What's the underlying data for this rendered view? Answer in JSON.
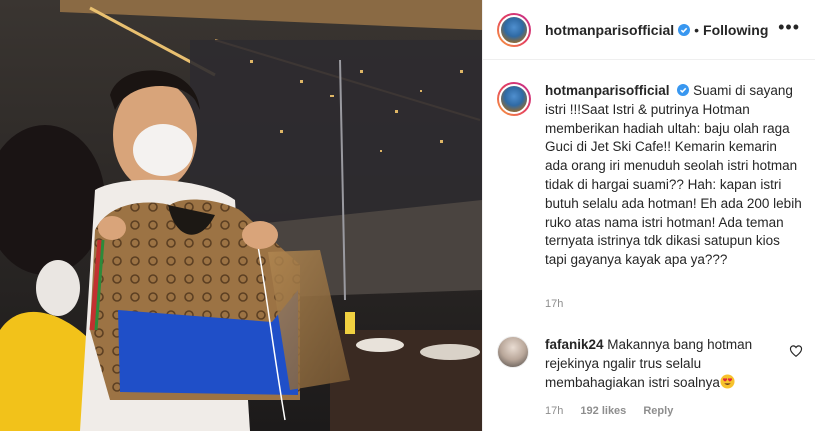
{
  "post": {
    "username": "hotmanparisofficial",
    "follow_status": "Following",
    "caption": "Suami di sayang istri !!!Saat Istri & putrinya Hotman memberikan hadiah ultah: baju olah raga Guci di Jet Ski Cafe!! Kemarin kemarin ada orang iri menuduh seolah istri hotman tidak di hargai suami?? Hah: kapan istri butuh selalu ada hotman! Eh ada 200 lebih ruko atas nama istri hotman! Ada teman ternyata istrinya tdk dikasi satupun kios tapi gayanya kayak apa ya???",
    "caption_time": "17h"
  },
  "comment": {
    "username": "fafanik24",
    "text": "Makannya bang hotman rejekinya ngalir trus selalu membahagiakan istri soalnya",
    "time": "17h",
    "likes": "192 likes",
    "reply": "Reply"
  },
  "icons": {
    "verified": "verified-badge-icon",
    "more": "more-options-icon",
    "heart": "heart-outline-icon",
    "emoji": "heart-eyes-emoji"
  },
  "colors": {
    "verified": "#3897f0",
    "muted": "#8e8e8e",
    "text": "#262626"
  }
}
